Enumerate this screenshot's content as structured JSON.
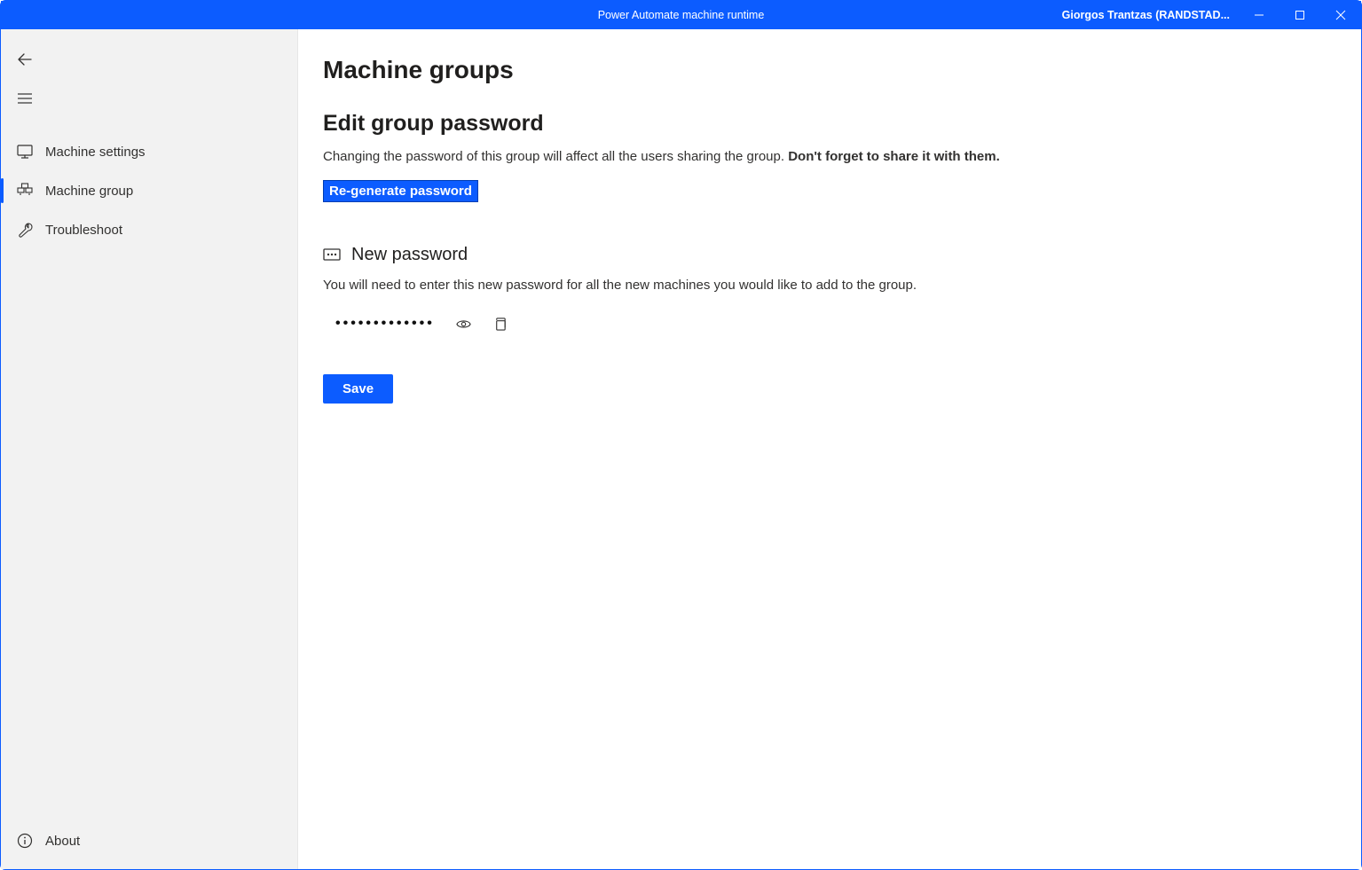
{
  "titlebar": {
    "title": "Power Automate machine runtime",
    "user": "Giorgos Trantzas (RANDSTAD..."
  },
  "sidebar": {
    "items": [
      {
        "label": "Machine settings"
      },
      {
        "label": "Machine group"
      },
      {
        "label": "Troubleshoot"
      }
    ],
    "about": "About"
  },
  "main": {
    "page_title": "Machine groups",
    "section_title": "Edit group password",
    "section_desc_prefix": "Changing the password of this group will affect all the users sharing the group. ",
    "section_desc_bold": "Don't forget to share it with them.",
    "regen_label": "Re-generate password",
    "pw_label": "New password",
    "pw_desc": "You will need to enter this new password for all the new machines you would like to add to the group.",
    "pw_value": "•••••••••••••",
    "save_label": "Save"
  }
}
